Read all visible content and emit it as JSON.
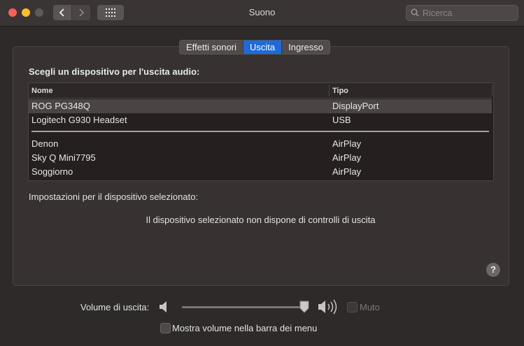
{
  "window": {
    "title": "Suono"
  },
  "search": {
    "placeholder": "Ricerca"
  },
  "tabs": [
    {
      "label": "Effetti sonori",
      "active": false
    },
    {
      "label": "Uscita",
      "active": true
    },
    {
      "label": "Ingresso",
      "active": false
    }
  ],
  "output": {
    "heading": "Scegli un dispositivo per l'uscita audio:",
    "columns": {
      "name": "Nome",
      "type": "Tipo"
    },
    "devices": [
      {
        "name": "ROG PG348Q",
        "type": "DisplayPort",
        "selected": true
      },
      {
        "name": "Logitech G930 Headset",
        "type": "USB",
        "selected": false
      },
      {
        "name": "Denon",
        "type": "AirPlay",
        "selected": false
      },
      {
        "name": "Sky Q Mini7795",
        "type": "AirPlay",
        "selected": false
      },
      {
        "name": "Soggiorno",
        "type": "AirPlay",
        "selected": false
      }
    ],
    "settings_label": "Impostazioni per il dispositivo selezionato:",
    "no_controls": "Il dispositivo selezionato non dispone di controlli di uscita",
    "help": "?"
  },
  "volume": {
    "label": "Volume di uscita:",
    "level": 0.97,
    "mute_label": "Muto",
    "mute_checked": false,
    "mute_enabled": false
  },
  "menubar_option": {
    "label": "Mostra volume nella barra dei menu",
    "checked": false
  },
  "colors": {
    "accent": "#1e6bd6",
    "close": "#fe5f57",
    "minimize": "#febc2e"
  }
}
